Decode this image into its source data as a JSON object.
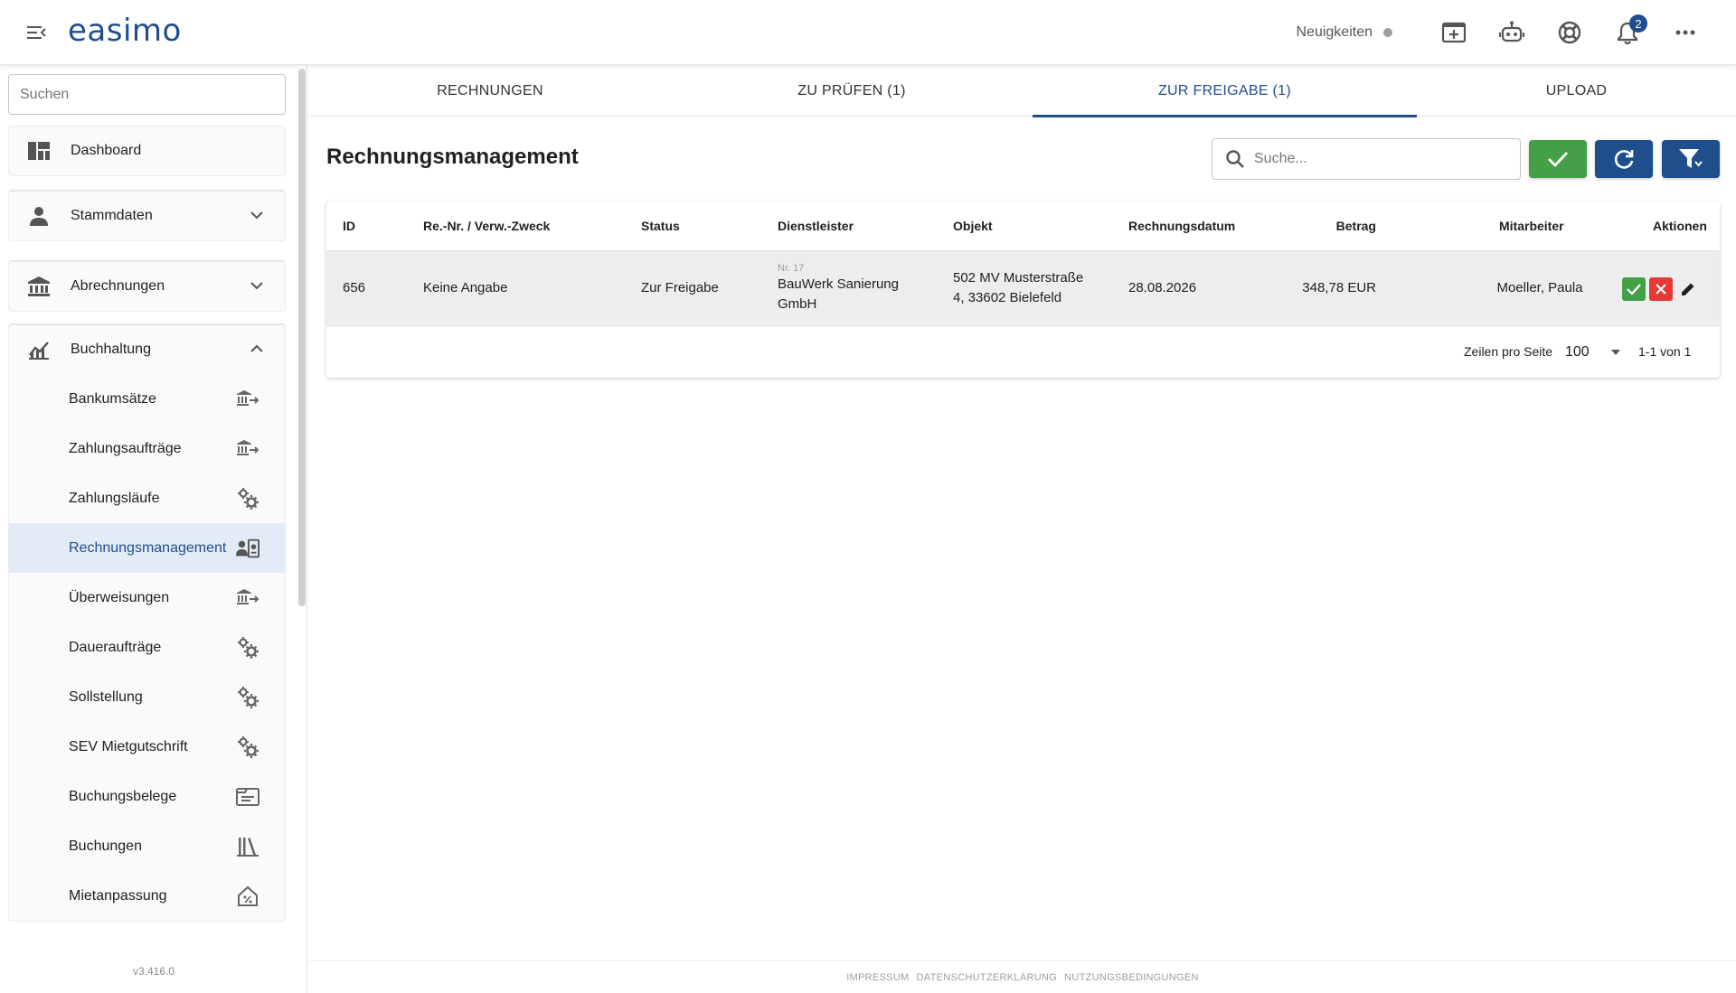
{
  "app": {
    "logo": "easimo",
    "version": "v3.416.0"
  },
  "topbar": {
    "news_label": "Neuigkeiten",
    "notification_count": "2"
  },
  "sidebar": {
    "search_placeholder": "Suchen",
    "dashboard": "Dashboard",
    "stammdaten": "Stammdaten",
    "abrechnungen": "Abrechnungen",
    "buchhaltung": "Buchhaltung",
    "sub_items": [
      {
        "label": "Bankumsätze",
        "icon": "bank-transfer-icon"
      },
      {
        "label": "Zahlungsaufträge",
        "icon": "bank-transfer-icon"
      },
      {
        "label": "Zahlungsläufe",
        "icon": "gears-icon"
      },
      {
        "label": "Rechnungsmanagement",
        "icon": "invoice-person-icon"
      },
      {
        "label": "Überweisungen",
        "icon": "bank-transfer-icon"
      },
      {
        "label": "Daueraufträge",
        "icon": "gears-icon"
      },
      {
        "label": "Sollstellung",
        "icon": "gears-icon"
      },
      {
        "label": "SEV Mietgutschrift",
        "icon": "gears-icon"
      },
      {
        "label": "Buchungsbelege",
        "icon": "document-icon"
      },
      {
        "label": "Buchungen",
        "icon": "books-icon"
      },
      {
        "label": "Mietanpassung",
        "icon": "house-percent-icon"
      }
    ]
  },
  "tabs": [
    {
      "label": "RECHNUNGEN"
    },
    {
      "label": "ZU PRÜFEN (1)"
    },
    {
      "label": "ZUR FREIGABE (1)"
    },
    {
      "label": "UPLOAD"
    }
  ],
  "main": {
    "title": "Rechnungsmanagement",
    "search_placeholder": "Suche...",
    "colors": {
      "approve": "#43a047",
      "reject": "#e53935",
      "primary": "#1f4e8c"
    }
  },
  "table": {
    "headers": {
      "id": "ID",
      "ref": "Re.-Nr. / Verw.-Zweck",
      "status": "Status",
      "provider": "Dienstleister",
      "object": "Objekt",
      "date": "Rechnungsdatum",
      "amount": "Betrag",
      "employee": "Mitarbeiter",
      "actions": "Aktionen"
    },
    "rows": [
      {
        "id": "656",
        "ref": "Keine Angabe",
        "status": "Zur Freigabe",
        "provider_nr": "Nr. 17",
        "provider_line1": "BauWerk Sanierung",
        "provider_line2": "GmbH",
        "object_line1": "502 MV Musterstraße",
        "object_line2": "4, 33602 Bielefeld",
        "date": "28.08.2026",
        "amount": "348,78 EUR",
        "employee": "Moeller, Paula"
      }
    ],
    "pager": {
      "rows_label": "Zeilen pro Seite",
      "rows_value": "100",
      "range": "1-1 von 1"
    }
  },
  "footer": {
    "impressum": "IMPRESSUM",
    "datenschutz": "DATENSCHUTZERKLÄRUNG",
    "nutzung": "NUTZUNGSBEDINGUNGEN"
  }
}
